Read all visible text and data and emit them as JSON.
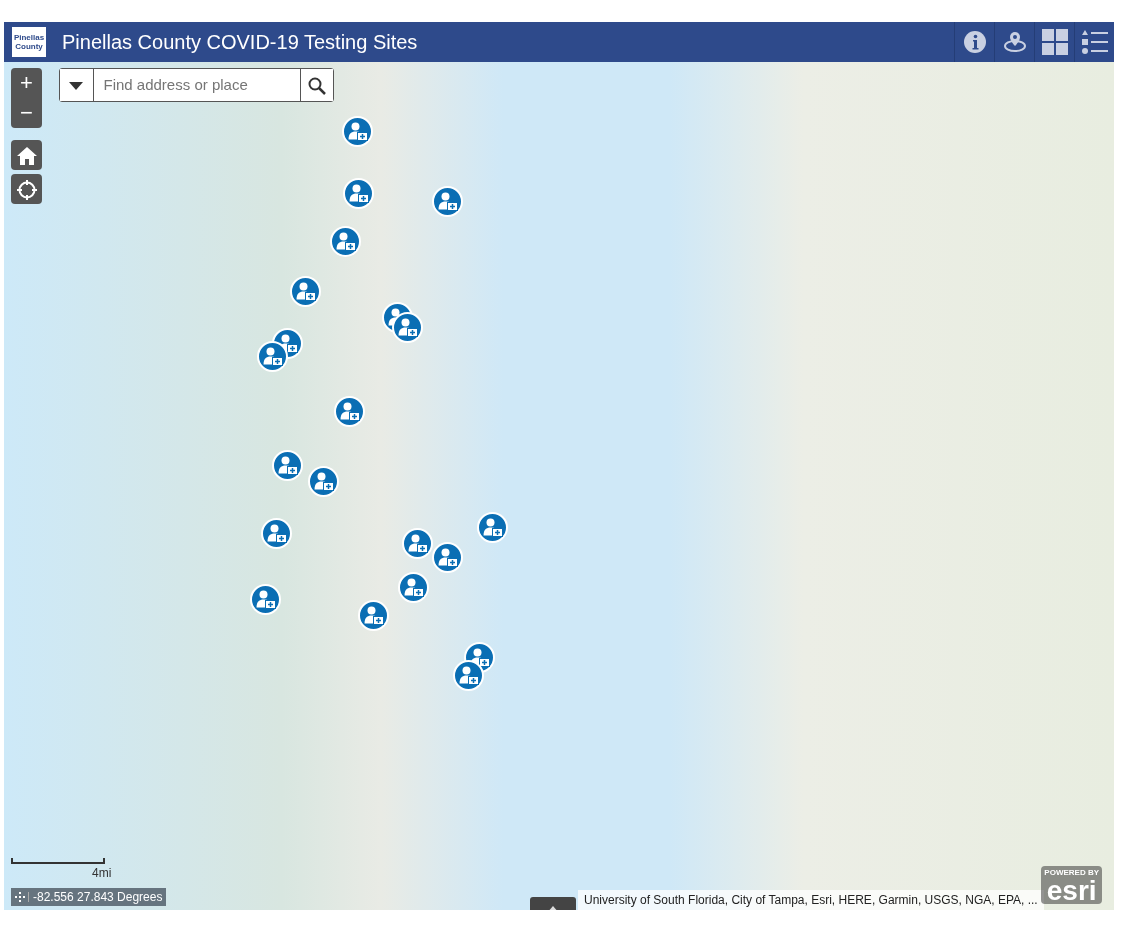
{
  "header": {
    "title": "Pinellas County COVID-19 Testing Sites",
    "logo_text": "Pinellas County"
  },
  "search": {
    "placeholder": "Find address or place"
  },
  "zoom_controls": [
    "+",
    "−"
  ],
  "scale_bar": {
    "label": "4mi"
  },
  "coordinates": {
    "text": "-82.556 27.843 Degrees"
  },
  "attribution": {
    "text": "University of South Florida, City of Tampa, Esri, HERE, Garmin, USGS, NGA, EPA, ..."
  },
  "esri_logo": {
    "tagline": "POWERED BY",
    "wordmark": "esri"
  }
}
